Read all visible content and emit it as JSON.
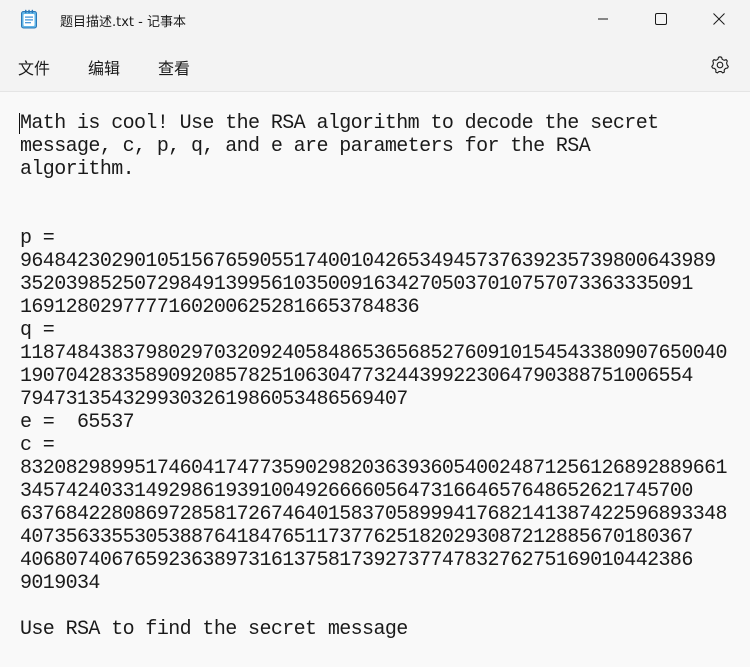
{
  "window": {
    "title": "题目描述.txt - 记事本",
    "app_icon": "notepad-icon",
    "controls": [
      "minimize-icon",
      "maximize-icon",
      "close-icon"
    ]
  },
  "menu": {
    "file": "文件",
    "edit": "编辑",
    "view": "查看",
    "settings_icon": "gear-icon"
  },
  "document": {
    "content": "Math is cool! Use the RSA algorithm to decode the secret\nmessage, c, p, q, and e are parameters for the RSA\nalgorithm.\n\n\np =\n9648423029010515676590551740010426534945737639235739800643989\n35203985250729849139956103500916342705037010757073363335091\n16912802977771602006252816653784836\nq =\n11874843837980297032092405848653656852760910154543380907650040\n19070428335890920857825106304773244399223064790388751006554\n7947313543299303261986053486569407\ne =  65537\nc =\n83208298995174604174773590298203639360540024871256126892889661\n34574240331492986193910049266660564731664657648652621745700\n63768422808697285817267464015837058999417682141387422596893348\n40735633553053887641847651173776251820293087212885670180367\n40680740676592363897316137581739273774783276275169010442386\n9019034\n\nUse RSA to find the secret message"
  }
}
